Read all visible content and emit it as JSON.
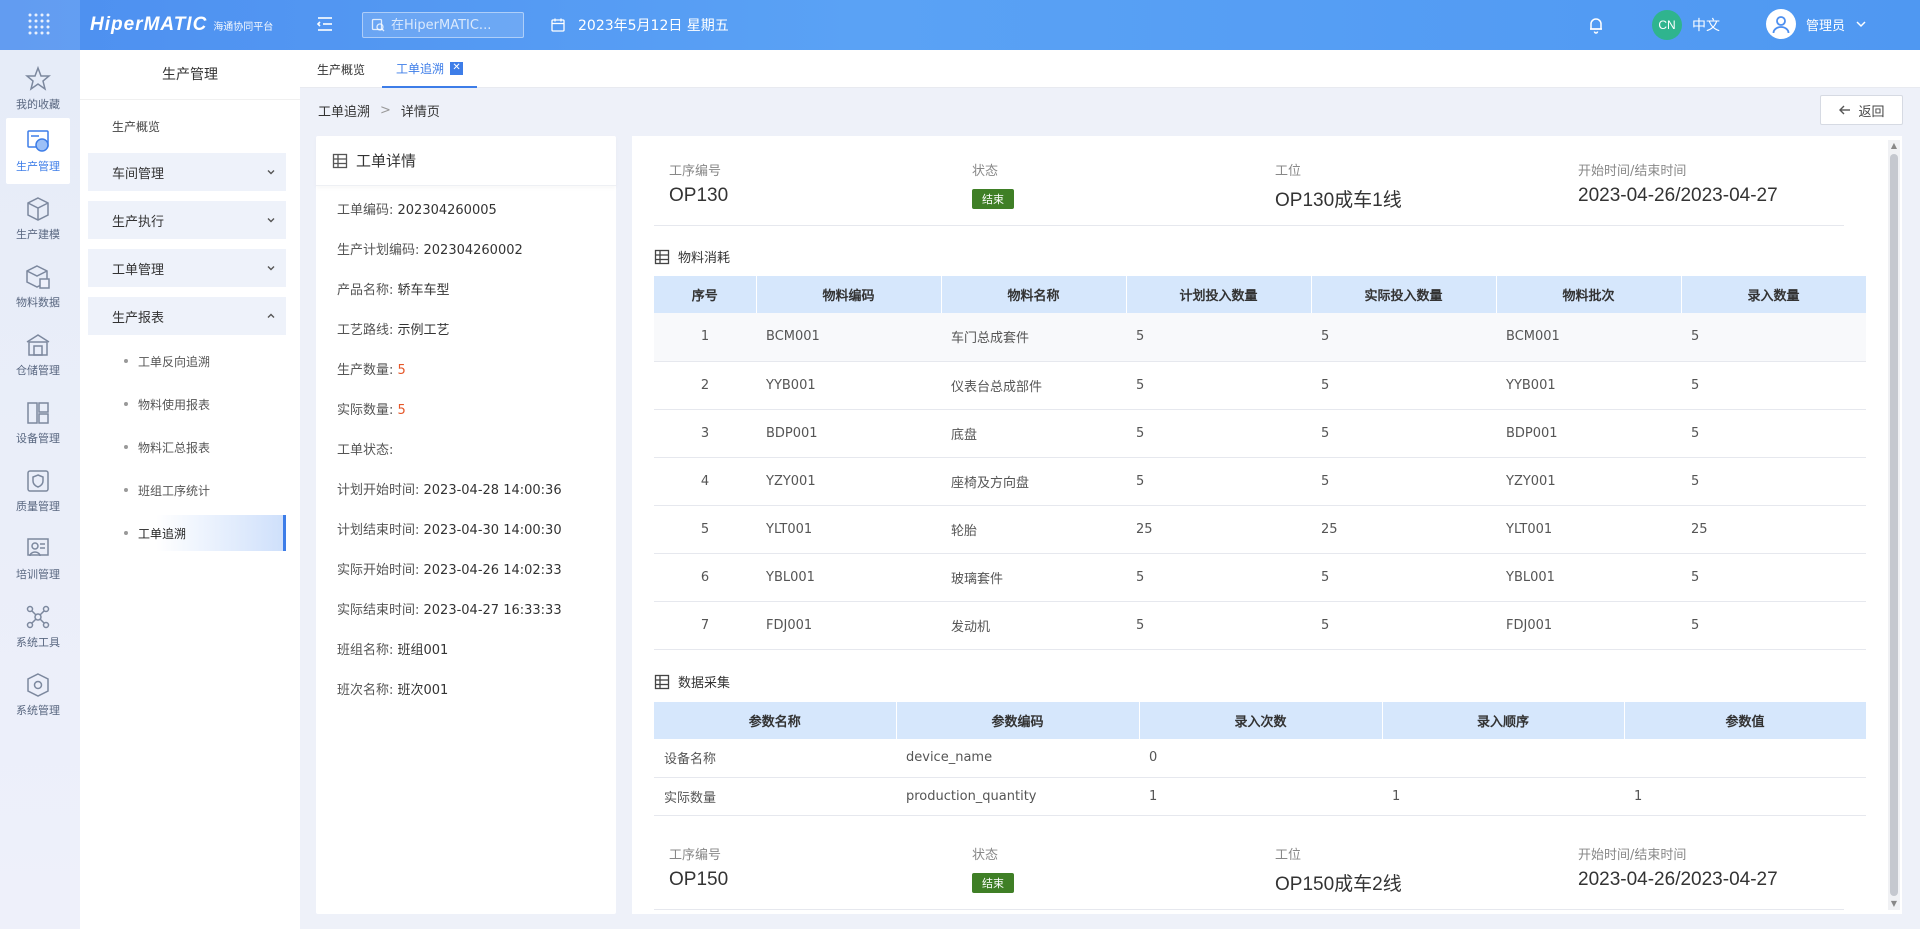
{
  "header": {
    "brand": "HiperMATIC",
    "brand_sub": "海通协同平台",
    "search_placeholder": "在HiperMATIC...",
    "date": "2023年5月12日 星期五",
    "lang_badge": "CN",
    "lang": "中文",
    "user": "管理员"
  },
  "iconbar": [
    {
      "label": "我的收藏",
      "icon": "star-icon"
    },
    {
      "label": "生产管理",
      "icon": "production-icon"
    },
    {
      "label": "生产建模",
      "icon": "cube-icon"
    },
    {
      "label": "物料数据",
      "icon": "box-icon"
    },
    {
      "label": "仓储管理",
      "icon": "warehouse-icon"
    },
    {
      "label": "设备管理",
      "icon": "device-icon"
    },
    {
      "label": "质量管理",
      "icon": "shield-icon"
    },
    {
      "label": "培训管理",
      "icon": "training-icon"
    },
    {
      "label": "系统工具",
      "icon": "network-icon"
    },
    {
      "label": "系统管理",
      "icon": "settings-cube-icon"
    }
  ],
  "sidenav": {
    "title": "生产管理",
    "overview": "生产概览",
    "groups": [
      "车间管理",
      "生产执行",
      "工单管理",
      "生产报表"
    ],
    "report_items": [
      "工单反向追溯",
      "物料使用报表",
      "物料汇总报表",
      "班组工序统计",
      "工单追溯"
    ]
  },
  "tabs": {
    "overview": "生产概览",
    "trace": "工单追溯"
  },
  "breadcrumb": {
    "parent": "工单追溯",
    "sep": ">",
    "current": "详情页"
  },
  "back_label": "返回",
  "detail": {
    "title": "工单详情",
    "fields": [
      {
        "label": "工单编码: ",
        "value": "202304260005",
        "red": false
      },
      {
        "label": "生产计划编码: ",
        "value": "202304260002",
        "red": false
      },
      {
        "label": "产品名称: ",
        "value": "轿车车型",
        "red": false
      },
      {
        "label": "工艺路线: ",
        "value": "示例工艺",
        "red": false
      },
      {
        "label": "生产数量: ",
        "value": "5",
        "red": true
      },
      {
        "label": "实际数量: ",
        "value": "5",
        "red": true
      },
      {
        "label": "工单状态: ",
        "value": "",
        "red": false
      },
      {
        "label": "计划开始时间: ",
        "value": "2023-04-28 14:00:36",
        "red": false
      },
      {
        "label": "计划结束时间: ",
        "value": "2023-04-30 14:00:30",
        "red": false
      },
      {
        "label": "实际开始时间: ",
        "value": "2023-04-26 14:02:33",
        "red": false
      },
      {
        "label": "实际结束时间: ",
        "value": "2023-04-27 16:33:33",
        "red": false
      },
      {
        "label": "班组名称: ",
        "value": "班组001",
        "red": false
      },
      {
        "label": "班次名称: ",
        "value": "班次001",
        "red": false
      }
    ]
  },
  "op_labels": {
    "code": "工序编号",
    "status": "状态",
    "station": "工位",
    "time": "开始时间/结束时间"
  },
  "op1": {
    "code": "OP130",
    "status": "结束",
    "station": "OP130成车1线",
    "time": "2023-04-26/2023-04-27"
  },
  "op2": {
    "code": "OP150",
    "status": "结束",
    "station": "OP150成车2线",
    "time": "2023-04-26/2023-04-27"
  },
  "material": {
    "title": "物料消耗",
    "columns": [
      "序号",
      "物料编码",
      "物料名称",
      "计划投入数量",
      "实际投入数量",
      "物料批次",
      "录入数量"
    ],
    "rows": [
      [
        "1",
        "BCM001",
        "车门总成套件",
        "5",
        "5",
        "BCM001",
        "5"
      ],
      [
        "2",
        "YYB001",
        "仪表台总成部件",
        "5",
        "5",
        "YYB001",
        "5"
      ],
      [
        "3",
        "BDP001",
        "底盘",
        "5",
        "5",
        "BDP001",
        "5"
      ],
      [
        "4",
        "YZY001",
        "座椅及方向盘",
        "5",
        "5",
        "YZY001",
        "5"
      ],
      [
        "5",
        "YLT001",
        "轮胎",
        "25",
        "25",
        "YLT001",
        "25"
      ],
      [
        "6",
        "YBL001",
        "玻璃套件",
        "5",
        "5",
        "YBL001",
        "5"
      ],
      [
        "7",
        "FDJ001",
        "发动机",
        "5",
        "5",
        "FDJ001",
        "5"
      ]
    ]
  },
  "collect": {
    "title": "数据采集",
    "columns": [
      "参数名称",
      "参数编码",
      "录入次数",
      "录入顺序",
      "参数值"
    ],
    "rows": [
      [
        "设备名称",
        "device_name",
        "0",
        "",
        ""
      ],
      [
        "实际数量",
        "production_quantity",
        "1",
        "1",
        "1"
      ]
    ]
  },
  "colors": {
    "primary": "#3d7de8",
    "badge": "#3f7f26",
    "table_header": "#d6e7fc",
    "red_value": "#e5582a"
  }
}
